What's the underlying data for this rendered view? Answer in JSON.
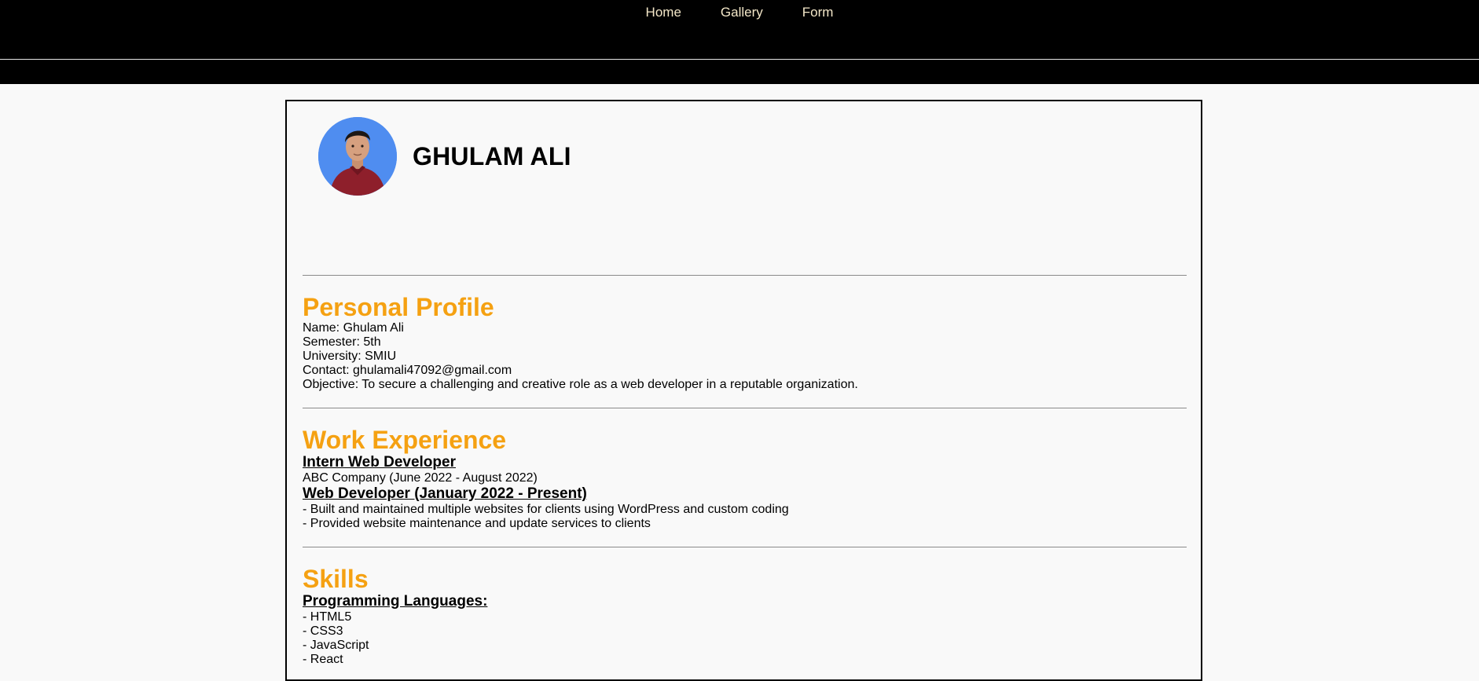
{
  "nav": {
    "items": [
      {
        "label": "Home"
      },
      {
        "label": "Gallery"
      },
      {
        "label": "Form"
      }
    ]
  },
  "header": {
    "name": "GHULAM ALI"
  },
  "personal_profile": {
    "title": "Personal Profile",
    "lines": [
      "Name: Ghulam Ali",
      "Semester: 5th",
      "University: SMIU",
      "Contact: ghulamali47092@gmail.com",
      "Objective: To secure a challenging and creative role as a web developer in a reputable organization."
    ]
  },
  "work_experience": {
    "title": "Work Experience",
    "job1_title": "Intern Web Developer",
    "job1_detail": "ABC Company (June 2022 - August 2022)",
    "job2_title": "Web Developer (January 2022 - Present)",
    "job2_points": [
      "- Built and maintained multiple websites for clients using WordPress and custom coding",
      "- Provided website maintenance and update services to clients"
    ]
  },
  "skills": {
    "title": "Skills",
    "subtitle": "Programming Languages:",
    "items": [
      "- HTML5",
      "- CSS3",
      "- JavaScript",
      "- React"
    ]
  },
  "colors": {
    "nav_bg": "#000000",
    "nav_text": "#f3e7c8",
    "accent": "#f5a112",
    "avatar_bg": "#4f8df0"
  }
}
